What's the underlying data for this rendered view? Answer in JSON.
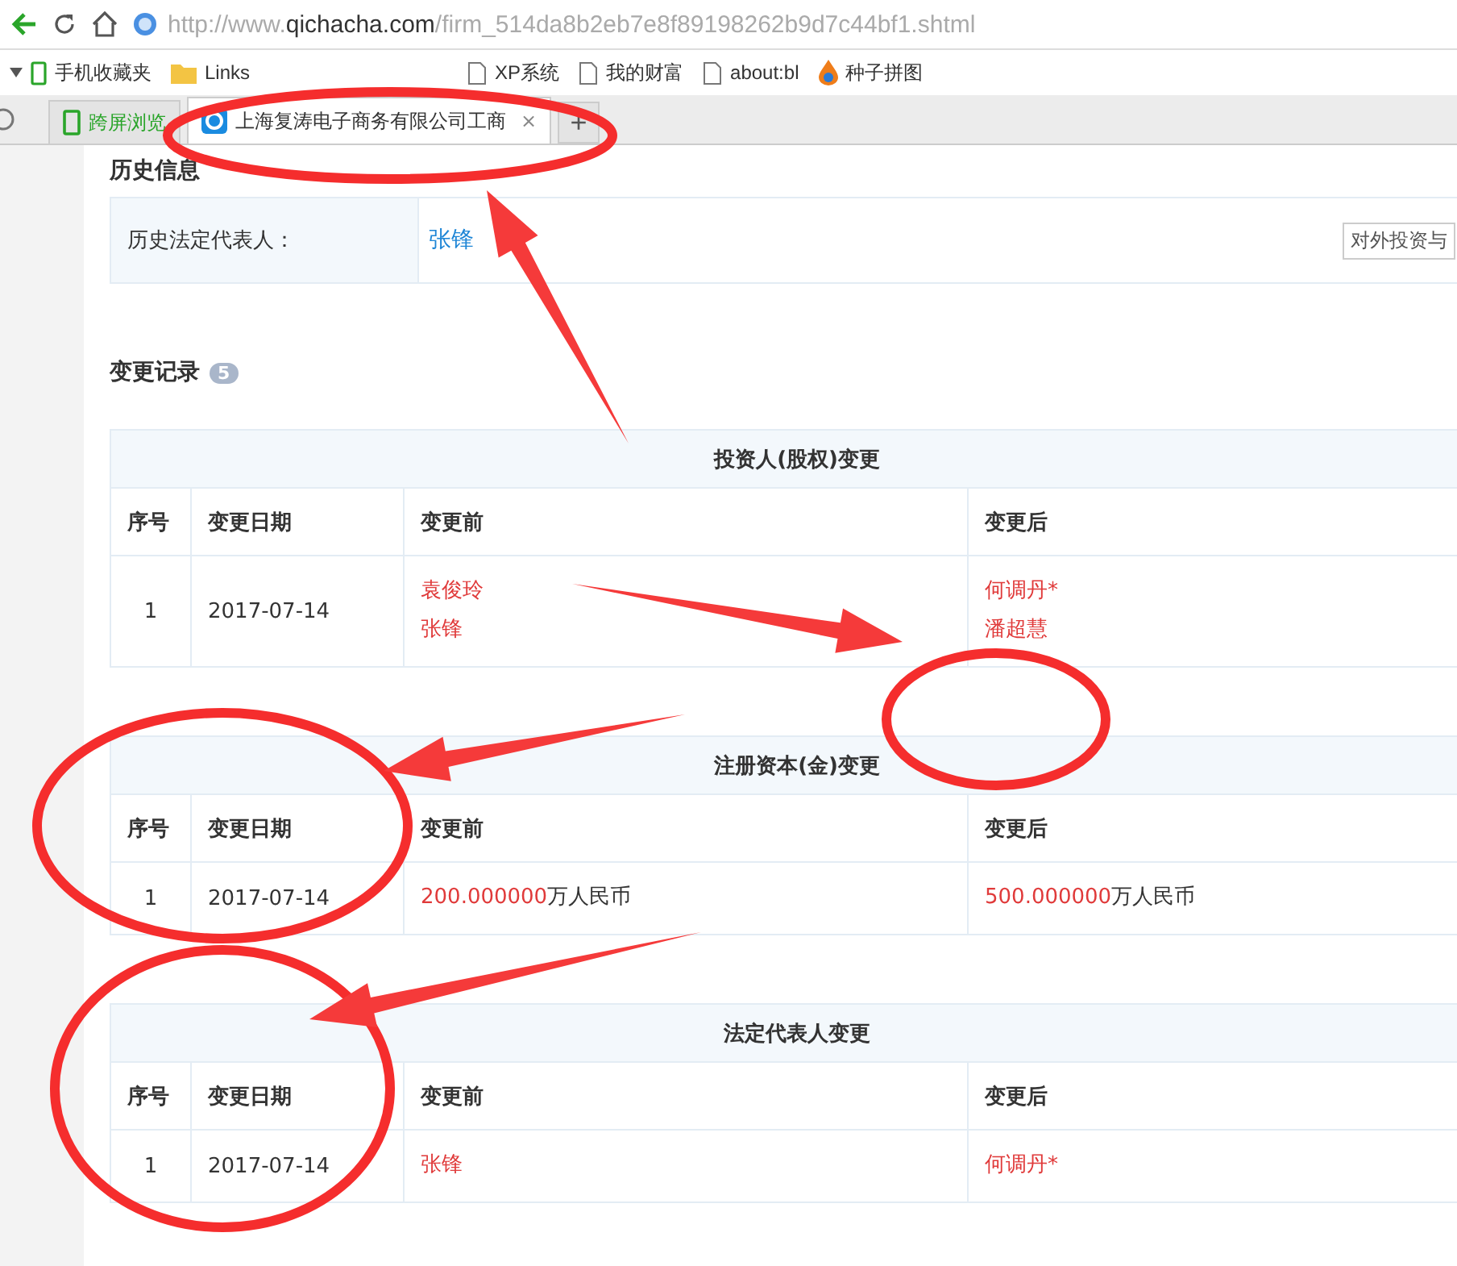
{
  "toolbar": {
    "url_parts": [
      {
        "text": "http://www.",
        "strong": false
      },
      {
        "text": "qichacha.com",
        "strong": true
      },
      {
        "text": "/firm_514da8b2eb7e8f89198262b9d7c44bf1.shtml",
        "strong": false
      }
    ]
  },
  "bookmarks": [
    {
      "label": "手机收藏夹",
      "kind": "phone"
    },
    {
      "label": "Links",
      "kind": "folder"
    },
    {
      "label": "XP系统",
      "kind": "page"
    },
    {
      "label": "我的财富",
      "kind": "page"
    },
    {
      "label": "about:bl",
      "kind": "page"
    },
    {
      "label": "种子拼图",
      "kind": "drop"
    }
  ],
  "tabs": [
    {
      "label": "跨屏浏览",
      "kind": "phone",
      "selected": false
    },
    {
      "label": "上海复涛电子商务有限公司工商",
      "kind": "site",
      "selected": true,
      "close": "×"
    }
  ],
  "new_tab": "+",
  "history": {
    "heading": "历史信息",
    "label": "历史法定代表人：",
    "value": "张锋",
    "button": "对外投资与"
  },
  "changes": {
    "heading": "变更记录",
    "count": "5",
    "tables": [
      {
        "title": "投资人(股权)变更",
        "columns": [
          "序号",
          "变更日期",
          "变更前",
          "变更后"
        ],
        "rows": [
          {
            "index": "1",
            "date": "2017-07-14",
            "before": [
              {
                "text": "袁俊玲"
              },
              {
                "text": "张锋"
              }
            ],
            "after": [
              {
                "text": "何调丹*"
              },
              {
                "text": "潘超慧"
              }
            ]
          }
        ]
      },
      {
        "title": "注册资本(金)变更",
        "columns": [
          "序号",
          "变更日期",
          "变更前",
          "变更后"
        ],
        "rows": [
          {
            "index": "1",
            "date": "2017-07-14",
            "before": [
              {
                "text": "200.000000",
                "unit": "万人民币"
              }
            ],
            "after": [
              {
                "text": "500.000000",
                "unit": "万人民币"
              }
            ]
          }
        ]
      },
      {
        "title": "法定代表人变更",
        "columns": [
          "序号",
          "变更日期",
          "变更前",
          "变更后"
        ],
        "rows": [
          {
            "index": "1",
            "date": "2017-07-14",
            "before": [
              {
                "text": "张锋"
              }
            ],
            "after": [
              {
                "text": "何调丹*"
              }
            ]
          }
        ]
      }
    ]
  }
}
